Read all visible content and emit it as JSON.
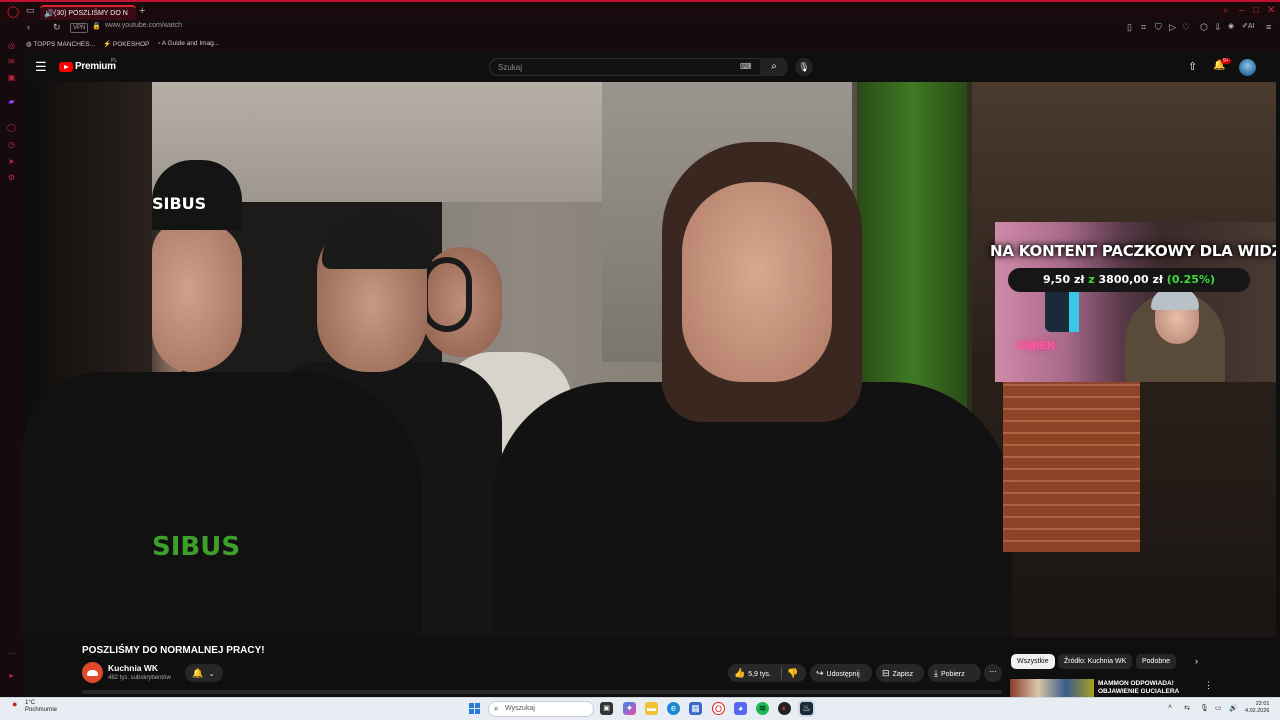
{
  "browser": {
    "tab_title": "(30) POSZLIŚMY DO N",
    "url": "www.youtube.com/watch",
    "vpn_label": "VPN",
    "bookmarks": [
      "TOPPS MANCHES...",
      "POKESHOP",
      "A Guide and Imag..."
    ],
    "ai_label": "AI"
  },
  "youtube": {
    "logo_text": "Premium",
    "region": "PL",
    "search_placeholder": "Szukaj",
    "notification_badge": "9+"
  },
  "overlay": {
    "headline": "NA KONTENT PACZKOWY DLA WIDZA",
    "amount": "9,50 zł",
    "z": "z",
    "goal": "3800,00 zł",
    "percent": "(0.25%)",
    "neon_sign": "GIBIEN"
  },
  "video_logos": [
    "SIBUS",
    "SIBUS"
  ],
  "video": {
    "title": "POSZLIŚMY DO NORMALNEJ PRACY!",
    "channel": "Kuchnia WK",
    "subscribers": "482 tys. subskrybentów",
    "likes": "5,9 tys.",
    "share_label": "Udostępnij",
    "save_label": "Zapisz",
    "download_label": "Pobierz"
  },
  "chips": [
    "Wszystkie",
    "Źródło: Kuchnia WK",
    "Podobne"
  ],
  "recommendation": {
    "title": "MAMMON ODPOWIADA! OBJAWIENIE GUCIALERA"
  },
  "taskbar": {
    "temperature": "1°C",
    "weather": "Pochmurnie",
    "search_placeholder": "Wyszukaj",
    "time": "22:01",
    "date": "4.02.2026"
  },
  "colors": {
    "accent_red": "#ff0000",
    "browser_accent": "#c01030",
    "donation_green": "#3cdc3c"
  }
}
